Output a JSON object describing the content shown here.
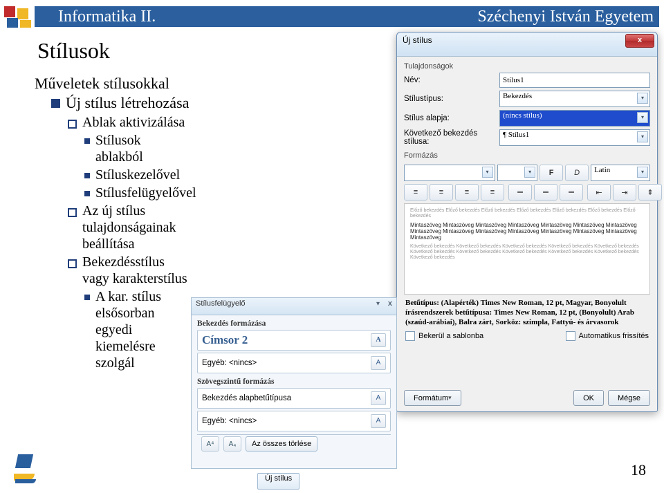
{
  "header": {
    "course": "Informatika II.",
    "university": "Széchenyi István Egyetem"
  },
  "page": {
    "title": "Stílusok",
    "number": "18"
  },
  "outline": {
    "heading": "Műveletek stílusokkal",
    "l2": [
      {
        "label": "Új stílus létrehozása",
        "l3": [
          {
            "label": "Ablak aktivizálása",
            "l4": [
              "Stílusok ablakból",
              "Stíluskezelővel",
              "Stílusfelügyelővel"
            ]
          },
          {
            "label": "Az új stílus tulajdonságainak beállítása"
          },
          {
            "label": "Bekezdésstílus vagy karakterstílus",
            "l4": [
              "A kar. stílus elsősorban egyedi kiemelésre szolgál"
            ]
          }
        ]
      }
    ]
  },
  "dialog": {
    "title": "Új stílus",
    "close_label": "x",
    "props_group": "Tulajdonságok",
    "name_label": "Név:",
    "name_value": "Stílus1",
    "type_label": "Stílustípus:",
    "type_value": "Bekezdés",
    "based_label": "Stílus alapja:",
    "based_value": "(nincs stílus)",
    "next_label": "Következő bekezdés stílusa:",
    "next_value": "¶ Stílus1",
    "format_group": "Formázás",
    "font_box": "",
    "font_bold": "F",
    "font_italic": "D",
    "lang_value": "Latin",
    "description": "Betűtípus: (Alapérték) Times New Roman, 12 pt, Magyar, Bonyolult írásrendszerek betűtípusa: Times New Roman, 12 pt, (Bonyolult) Arab (szaúd-arábiai), Balra zárt, Sorköz:  szimpla, Fattyú- és árvasorok",
    "sample_minor": "Előző bekezdés Előző bekezdés Előző bekezdés Előző bekezdés Előző bekezdés Előző bekezdés Előző bekezdés",
    "sample_major": "Mintaszöveg Mintaszöveg Mintaszöveg Mintaszöveg Mintaszöveg Mintaszöveg Mintaszöveg Mintaszöveg Mintaszöveg Mintaszöveg Mintaszöveg Mintaszöveg Mintaszöveg Mintaszöveg Mintaszöveg",
    "sample_after": "Következő bekezdés Következő bekezdés Következő bekezdés Következő bekezdés Következő bekezdés Következő bekezdés Következő bekezdés Következő bekezdés Következő bekezdés Következő bekezdés Következő bekezdés",
    "chk_template": "Bekerül a sablonba",
    "chk_auto": "Automatikus frissítés",
    "format_button": "Formátum",
    "ok_button": "OK",
    "cancel_button": "Mégse"
  },
  "inspector": {
    "title": "Stílusfelügyelő",
    "pane_drop": "▾",
    "pane_close": "x",
    "para_format_label": "Bekezdés formázása",
    "para_style_value": "Címsor 2",
    "other_none": "Egyéb: <nincs>",
    "text_format_label": "Szövegszintű formázás",
    "char_style_value": "Bekezdés alapbetűtípusa",
    "icon_label_a": "A",
    "clear_all": "Az összes törlése"
  },
  "bottom_button": {
    "label": "Új stílus"
  }
}
